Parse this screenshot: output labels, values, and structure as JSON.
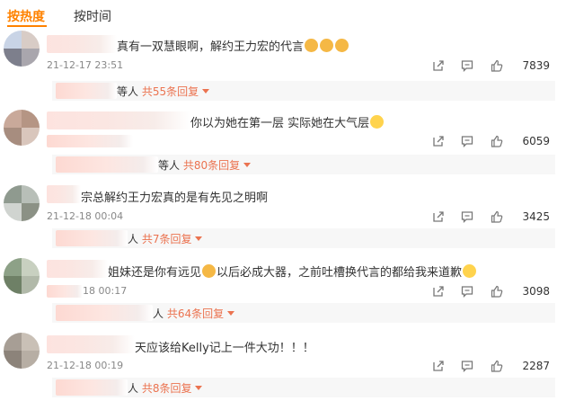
{
  "tabs": {
    "hot": "按热度",
    "time": "按时间"
  },
  "comments": [
    {
      "text": "真有一双慧眼啊，解约王力宏的代言",
      "time": "21-12-17 23:51",
      "likes": "7839",
      "reply_suffix": "等人",
      "reply_more": "共55条回复"
    },
    {
      "text": "你以为她在第一层 实际她在大气层",
      "time": "",
      "likes": "6059",
      "reply_suffix": "等人",
      "reply_more": "共80条回复"
    },
    {
      "text": "宗总解约王力宏真的是有先见之明啊",
      "time": "21-12-18 00:04",
      "likes": "3425",
      "reply_suffix": "人",
      "reply_more": "共7条回复"
    },
    {
      "text_a": "姐妹还是你有远见",
      "text_b": "以后必成大器，之前吐槽换代言的都给我来道歉",
      "time": "18 00:17",
      "likes": "3098",
      "reply_suffix": "人",
      "reply_more": "共64条回复"
    },
    {
      "text": "天应该给Kelly记上一件大功！！！",
      "time": "21-12-18 00:19",
      "likes": "2287",
      "reply_suffix": "人",
      "reply_more": "共8条回复"
    }
  ],
  "colors": {
    "accent": "#ff8200",
    "reply_link": "#eb7350"
  }
}
